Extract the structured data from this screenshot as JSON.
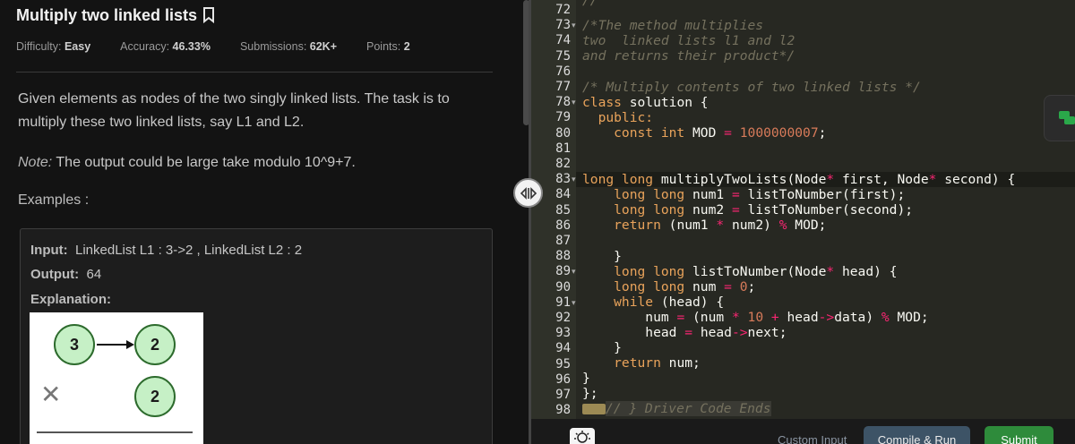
{
  "problem": {
    "title": "Multiply two linked lists",
    "difficulty_label": "Difficulty:",
    "difficulty": "Easy",
    "accuracy_label": "Accuracy:",
    "accuracy": "46.33%",
    "submissions_label": "Submissions:",
    "submissions": "62K+",
    "points_label": "Points:",
    "points": "2",
    "desc_line1": "Given elements as nodes of the two singly linked lists. The task is to",
    "desc_line2": "multiply these two linked lists, say L1 and L2.",
    "note_label": "Note:",
    "note_text": " The output could be large take modulo 10^9+7.",
    "examples_label": "Examples :"
  },
  "example": {
    "input_label": "Input:",
    "input_value": "LinkedList L1 : 3->2 , LinkedList L2 : 2",
    "output_label": "Output:",
    "output_value": "64",
    "explanation_label": "Explanation:",
    "diagram": {
      "l1_nodes": [
        "3",
        "2"
      ],
      "l2_nodes": [
        "2"
      ],
      "operator": "✕"
    }
  },
  "editor": {
    "lines": [
      {
        "n": "72",
        "fold": false
      },
      {
        "n": "73",
        "fold": true
      },
      {
        "n": "74",
        "fold": false
      },
      {
        "n": "75",
        "fold": false
      },
      {
        "n": "76",
        "fold": false
      },
      {
        "n": "77",
        "fold": false
      },
      {
        "n": "78",
        "fold": true
      },
      {
        "n": "79",
        "fold": false
      },
      {
        "n": "80",
        "fold": false
      },
      {
        "n": "81",
        "fold": false
      },
      {
        "n": "82",
        "fold": false
      },
      {
        "n": "83",
        "fold": true
      },
      {
        "n": "84",
        "fold": false
      },
      {
        "n": "85",
        "fold": false
      },
      {
        "n": "86",
        "fold": false
      },
      {
        "n": "87",
        "fold": false
      },
      {
        "n": "88",
        "fold": false
      },
      {
        "n": "89",
        "fold": true
      },
      {
        "n": "90",
        "fold": false
      },
      {
        "n": "91",
        "fold": true
      },
      {
        "n": "92",
        "fold": false
      },
      {
        "n": "93",
        "fold": false
      },
      {
        "n": "94",
        "fold": false
      },
      {
        "n": "95",
        "fold": false
      },
      {
        "n": "96",
        "fold": false
      },
      {
        "n": "97",
        "fold": false
      },
      {
        "n": "98",
        "fold": false
      }
    ],
    "code": {
      "l73": "/*The method multiplies",
      "l74": "two  linked lists l1 and l2",
      "l75": "and returns their product*/",
      "l77": "/* Multiply contents of two linked lists */",
      "l78_kw": "class",
      "l78_rest": " solution {",
      "l79": "  public:",
      "l80_a": "    const int MOD ",
      "l80_eq": "=",
      "l80_num": " 1000000007",
      "l80_end": ";",
      "l83_a": "long long",
      "l83_b": " multiplyTwoLists(Node",
      "l83_c": "*",
      "l83_d": " first, Node",
      "l83_e": "*",
      "l83_f": " second) {",
      "l84_a": "    long long",
      "l84_b": " num1 ",
      "l84_c": "=",
      "l84_d": " listToNumber(first);",
      "l85_a": "    long long",
      "l85_b": " num2 ",
      "l85_c": "=",
      "l85_d": " listToNumber(second);",
      "l86_a": "    return",
      "l86_b": " (num1 ",
      "l86_c": "*",
      "l86_d": " num2) ",
      "l86_e": "%",
      "l86_f": " MOD;",
      "l88": "    }",
      "l89_a": "    long long",
      "l89_b": " listToNumber(Node",
      "l89_c": "*",
      "l89_d": " head) {",
      "l90_a": "    long long",
      "l90_b": " num ",
      "l90_c": "=",
      "l90_d": " 0",
      "l90_e": ";",
      "l91_a": "    while",
      "l91_b": " (head) {",
      "l92_a": "        num ",
      "l92_b": "=",
      "l92_c": " (num ",
      "l92_d": "*",
      "l92_e": " 10",
      "l92_f": " + ",
      "l92_g": "head",
      "l92_h": "->",
      "l92_i": "data) ",
      "l92_j": "%",
      "l92_k": " MOD;",
      "l93_a": "        head ",
      "l93_b": "=",
      "l93_c": " head",
      "l93_d": "->",
      "l93_e": "next;",
      "l94": "    }",
      "l95_a": "    return",
      "l95_b": " num;",
      "l96": "}",
      "l97": "};",
      "l98": "// } Driver Code Ends"
    }
  },
  "toolbar": {
    "custom_input": "Custom Input",
    "compile_run": "Compile & Run",
    "submit": "Submit"
  }
}
